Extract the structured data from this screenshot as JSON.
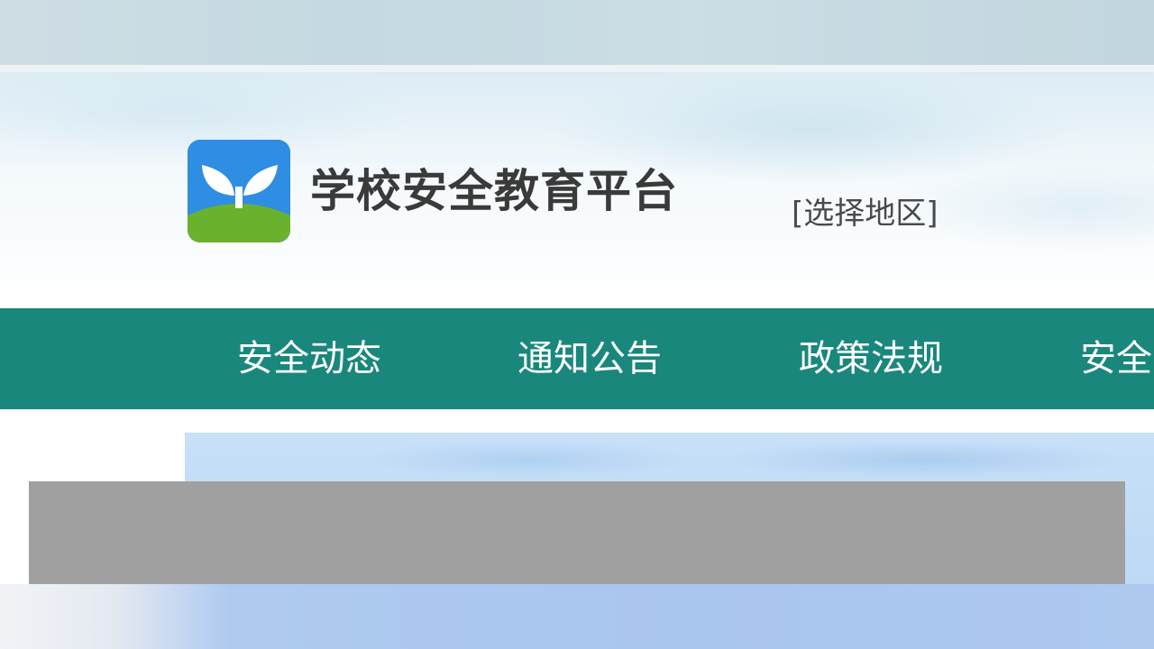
{
  "header": {
    "site_title": "学校安全教育平台",
    "region_select": "[选择地区]"
  },
  "logo": {
    "icon": "sprout-logo-icon",
    "colors": {
      "sky": "#2f8ee3",
      "leaf": "#ffffff",
      "hill": "#6ab22e"
    }
  },
  "nav": {
    "items": [
      {
        "label": "安全动态"
      },
      {
        "label": "通知公告"
      },
      {
        "label": "政策法规"
      },
      {
        "label": "安全"
      }
    ]
  },
  "colors": {
    "nav_background": "#1a877d",
    "nav_text": "#ffffff",
    "title_text": "#3a3a3a",
    "caption_bar": "#a0a0a0",
    "banner": "#c8e0f8"
  }
}
